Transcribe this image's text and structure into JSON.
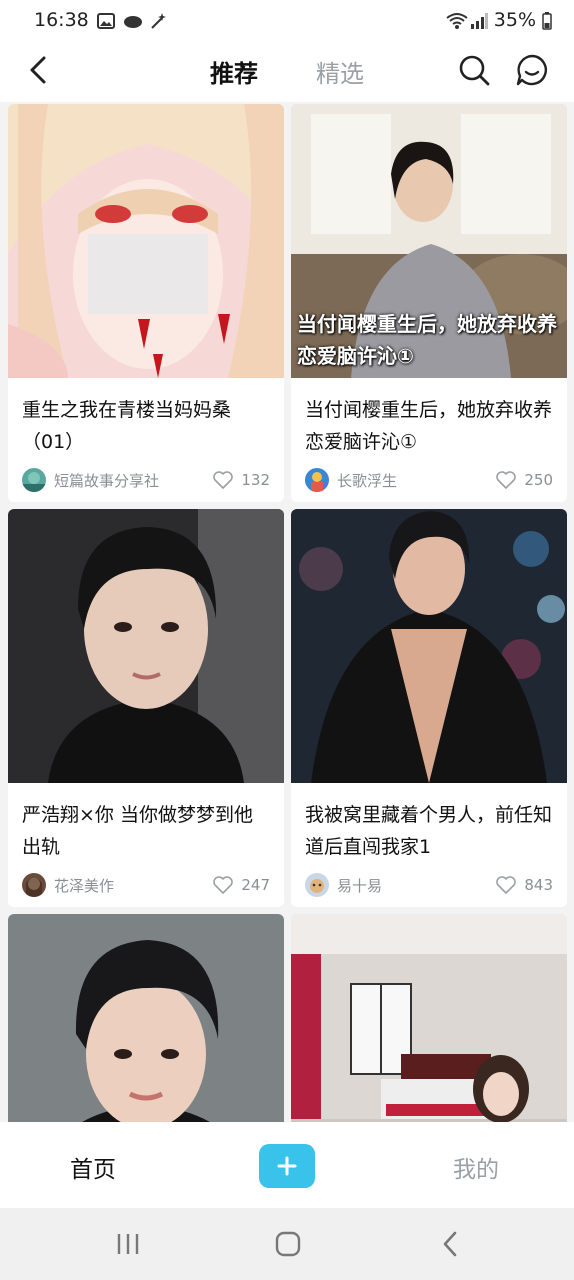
{
  "status": {
    "time": "16:38",
    "battery": "35%",
    "icons": [
      "image-icon",
      "cloud-icon",
      "magic-wand-icon",
      "wifi-icon",
      "signal-icon",
      "battery-icon"
    ]
  },
  "topnav": {
    "tabs": [
      {
        "label": "推荐",
        "active": true
      },
      {
        "label": "精选",
        "active": false
      }
    ],
    "icons": [
      "back-icon",
      "search-icon",
      "message-icon"
    ]
  },
  "cards": [
    {
      "title": "重生之我在青楼当妈妈桑（01）",
      "author": "短篇故事分享社",
      "likes": "132",
      "cover_caption": ""
    },
    {
      "title": "当付闻樱重生后，她放弃收养恋爱脑许沁①",
      "author": "长歌浮生",
      "likes": "250",
      "cover_caption": "当付闻樱重生后，她放弃收养恋爱脑许沁①"
    },
    {
      "title": "严浩翔×你 当你做梦梦到他出轨",
      "author": "花泽美作",
      "likes": "247",
      "cover_caption": ""
    },
    {
      "title": "我被窝里藏着个男人，前任知道后直闯我家1",
      "author": "易十易",
      "likes": "843",
      "cover_caption": ""
    },
    {
      "title": "",
      "author": "",
      "likes": "",
      "cover_caption": ""
    },
    {
      "title": "",
      "author": "",
      "likes": "",
      "cover_caption": ""
    }
  ],
  "bottomnav": {
    "home": "首页",
    "plus": "+",
    "mine": "我的"
  },
  "sysnav": {
    "icons": [
      "recent-apps-icon",
      "home-icon",
      "back-icon"
    ]
  },
  "colors": {
    "accent": "#39c3ea",
    "muted": "#9aa0a6",
    "background": "#f3f3f3"
  }
}
